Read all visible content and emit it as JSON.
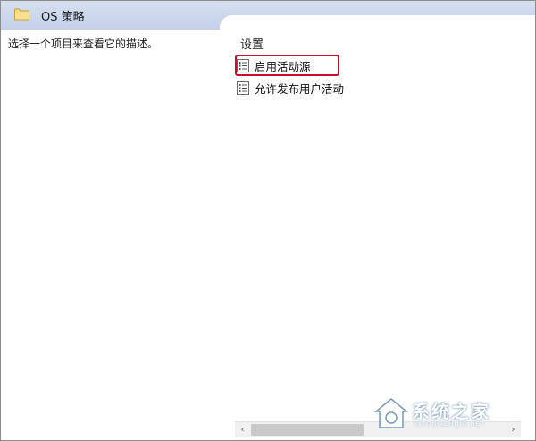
{
  "header": {
    "folder_icon": "folder-icon",
    "title": "OS 策略"
  },
  "description": {
    "text": "选择一个项目来查看它的描述。"
  },
  "list": {
    "column_header": "设置",
    "items": [
      {
        "label": "启用活动源",
        "icon": "policy-setting-icon",
        "selected": true
      },
      {
        "label": "允许发布用户活动",
        "icon": "policy-setting-icon",
        "selected": false
      }
    ]
  },
  "scrollbar": {
    "left_arrow": "‹",
    "right_arrow": "›"
  },
  "watermark": {
    "text": "系统之家",
    "sub": "XITONGZHIJIA.NET"
  },
  "colors": {
    "header_bg": "#c8d4ec",
    "selection_outline": "#c8102e",
    "folder": "#e8c15a"
  }
}
